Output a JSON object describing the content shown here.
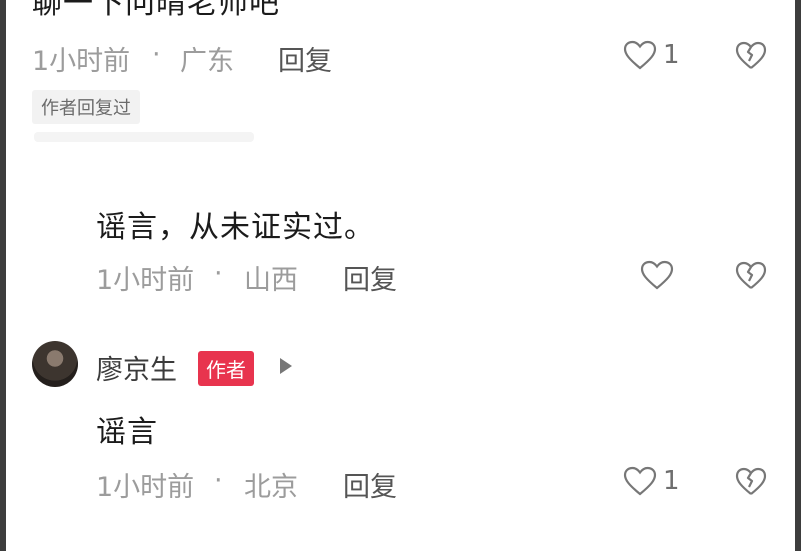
{
  "comments": [
    {
      "text": "聊一下问晴老师吧",
      "time": "1小时前",
      "location": "广东",
      "separator": "·",
      "reply_label": "回复",
      "likes": "1",
      "tag": "作者回复过"
    },
    {
      "text": "谣言，从未证实过。",
      "time": "1小时前",
      "location": "山西",
      "separator": "·",
      "reply_label": "回复",
      "likes": ""
    },
    {
      "author": "廖京生",
      "author_badge": "作者",
      "text": "谣言",
      "time": "1小时前",
      "location": "北京",
      "separator": "·",
      "reply_label": "回复",
      "likes": "1"
    }
  ],
  "icons": {
    "like": "heart-outline-icon",
    "dislike": "broken-heart-icon",
    "play": "play-triangle-icon"
  },
  "colors": {
    "author_badge_bg": "#e8344e",
    "meta_text": "#9c9c9c",
    "frame": "#3d3d3d"
  }
}
